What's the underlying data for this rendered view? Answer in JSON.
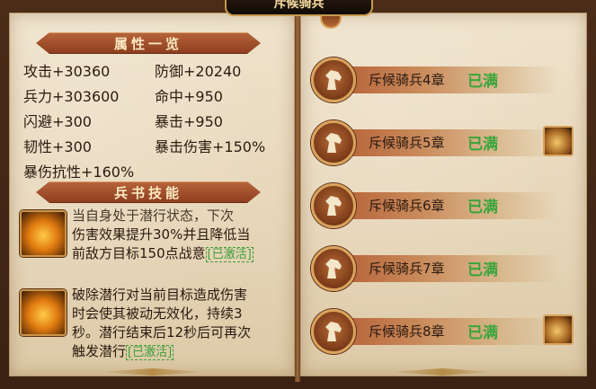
{
  "banner": {
    "title": "斥候骑兵"
  },
  "left": {
    "attributes_header": "属性一览",
    "attributes": [
      {
        "text": "攻击+30360"
      },
      {
        "text": "防御+20240"
      },
      {
        "text": "兵力+303600"
      },
      {
        "text": "命中+950"
      },
      {
        "text": "闪避+300"
      },
      {
        "text": "暴击+950"
      },
      {
        "text": "韧性+300"
      },
      {
        "text": "暴击伤害+150%"
      },
      {
        "text": "暴伤抗性+160%"
      }
    ],
    "skills_header": "兵书技能",
    "skills": [
      {
        "icon": "slash-skill-icon",
        "line1": "当自身处于潜行状态，下次",
        "line2": "伤害效果提升30%并且降低当",
        "line3": "前敌方目标150点战意",
        "status": "[已激活]"
      },
      {
        "icon": "stealth-break-skill-icon",
        "line1": "破除潜行对当前目标造成伤害",
        "line2": "时会使其被动无效化，持续3",
        "line3": "秒。潜行结束后12秒后可再次",
        "line4": "触发潜行",
        "status": "[已激活]"
      }
    ]
  },
  "right": {
    "chapters": [
      {
        "name": "斥候骑兵4章",
        "status": "已满",
        "has_reward": false
      },
      {
        "name": "斥候骑兵5章",
        "status": "已满",
        "has_reward": true
      },
      {
        "name": "斥候骑兵6章",
        "status": "已满",
        "has_reward": false
      },
      {
        "name": "斥候骑兵7章",
        "status": "已满",
        "has_reward": false
      },
      {
        "name": "斥候骑兵8章",
        "status": "已满",
        "has_reward": true
      }
    ]
  },
  "colors": {
    "status_green": "#3aa53a",
    "header_red": "#8e3f1f",
    "gold": "#d9a35e"
  }
}
